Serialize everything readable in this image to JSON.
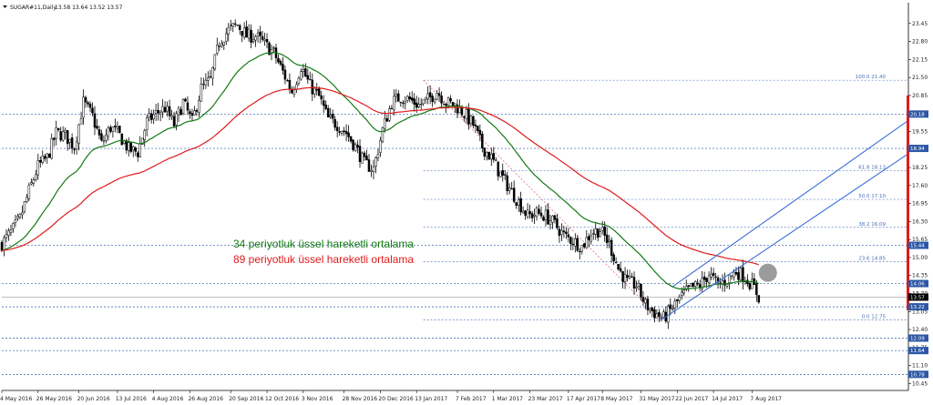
{
  "chart_data": {
    "type": "candlestick",
    "title": "SUGAR#11,Daily",
    "ohlc_label": "13.58 13.64 13.52 13.57",
    "symbol_menu_icon": "triangle-down-icon",
    "ylim": [
      10.2,
      24.2
    ],
    "y_ticks": [
      "23.45",
      "22.80",
      "22.15",
      "21.50",
      "20.85",
      "20.20",
      "19.55",
      "18.90",
      "18.25",
      "17.60",
      "16.95",
      "16.30",
      "15.65",
      "15.00",
      "14.35",
      "13.70",
      "13.05",
      "12.40",
      "11.75",
      "11.10",
      "10.45"
    ],
    "x_ticks": [
      {
        "label": "4 May 2016",
        "t": 0
      },
      {
        "label": "26 May 2016",
        "t": 16
      },
      {
        "label": "20 Jun 2016",
        "t": 34
      },
      {
        "label": "13 Jul 2016",
        "t": 51
      },
      {
        "label": "4 Aug 2016",
        "t": 67
      },
      {
        "label": "26 Aug 2016",
        "t": 83
      },
      {
        "label": "20 Sep 2016",
        "t": 101
      },
      {
        "label": "12 Oct 2016",
        "t": 117
      },
      {
        "label": "3 Nov 2016",
        "t": 133
      },
      {
        "label": "28 Nov 2016",
        "t": 151
      },
      {
        "label": "20 Dec 2016",
        "t": 167
      },
      {
        "label": "13 Jan 2017",
        "t": 183
      },
      {
        "label": "7 Feb 2017",
        "t": 201
      },
      {
        "label": "1 Mar 2017",
        "t": 217
      },
      {
        "label": "23 Mar 2017",
        "t": 233
      },
      {
        "label": "17 Apr 2017",
        "t": 250
      },
      {
        "label": "8 May 2017",
        "t": 265
      },
      {
        "label": "31 May 2017",
        "t": 282
      },
      {
        "label": "22 Jun 2017",
        "t": 298
      },
      {
        "label": "14 Jul 2017",
        "t": 314
      },
      {
        "label": "7 Aug 2017",
        "t": 331
      }
    ],
    "price_anchors": [
      [
        0,
        15.5
      ],
      [
        4,
        15.9
      ],
      [
        8,
        16.4
      ],
      [
        12,
        17.4
      ],
      [
        16,
        18.3
      ],
      [
        20,
        18.6
      ],
      [
        24,
        19.5
      ],
      [
        28,
        19.4
      ],
      [
        32,
        19.0
      ],
      [
        36,
        20.6
      ],
      [
        40,
        20.1
      ],
      [
        44,
        19.1
      ],
      [
        48,
        19.7
      ],
      [
        52,
        19.4
      ],
      [
        56,
        18.9
      ],
      [
        60,
        18.8
      ],
      [
        64,
        19.9
      ],
      [
        68,
        20.2
      ],
      [
        72,
        20.4
      ],
      [
        76,
        19.8
      ],
      [
        80,
        20.6
      ],
      [
        84,
        19.9
      ],
      [
        88,
        21.1
      ],
      [
        92,
        21.4
      ],
      [
        96,
        22.8
      ],
      [
        100,
        23.2
      ],
      [
        104,
        23.4
      ],
      [
        108,
        23.0
      ],
      [
        112,
        23.0
      ],
      [
        116,
        22.7
      ],
      [
        120,
        22.4
      ],
      [
        124,
        21.7
      ],
      [
        128,
        21.0
      ],
      [
        132,
        21.9
      ],
      [
        136,
        21.2
      ],
      [
        140,
        20.8
      ],
      [
        144,
        20.0
      ],
      [
        148,
        19.8
      ],
      [
        152,
        19.5
      ],
      [
        156,
        19.0
      ],
      [
        160,
        18.4
      ],
      [
        164,
        18.2
      ],
      [
        168,
        19.6
      ],
      [
        172,
        20.6
      ],
      [
        176,
        20.8
      ],
      [
        180,
        20.7
      ],
      [
        184,
        20.5
      ],
      [
        188,
        20.7
      ],
      [
        192,
        21.0
      ],
      [
        196,
        20.6
      ],
      [
        200,
        20.5
      ],
      [
        204,
        20.2
      ],
      [
        208,
        19.8
      ],
      [
        212,
        19.0
      ],
      [
        216,
        18.6
      ],
      [
        220,
        18.0
      ],
      [
        224,
        17.5
      ],
      [
        228,
        17.0
      ],
      [
        232,
        16.5
      ],
      [
        236,
        16.6
      ],
      [
        240,
        16.5
      ],
      [
        244,
        16.2
      ],
      [
        248,
        15.8
      ],
      [
        252,
        15.6
      ],
      [
        256,
        15.4
      ],
      [
        260,
        15.9
      ],
      [
        264,
        16.0
      ],
      [
        268,
        15.5
      ],
      [
        272,
        14.6
      ],
      [
        276,
        14.1
      ],
      [
        280,
        14.0
      ],
      [
        284,
        13.3
      ],
      [
        288,
        13.0
      ],
      [
        292,
        12.8
      ],
      [
        296,
        13.2
      ],
      [
        300,
        13.6
      ],
      [
        304,
        13.9
      ],
      [
        308,
        14.0
      ],
      [
        312,
        14.4
      ],
      [
        316,
        14.0
      ],
      [
        320,
        14.2
      ],
      [
        324,
        14.5
      ],
      [
        328,
        14.3
      ],
      [
        332,
        13.9
      ],
      [
        334,
        13.57
      ]
    ],
    "series": [
      {
        "name": "34 periyotluk üssel hareketli ortalama",
        "color": "#137a13"
      },
      {
        "name": "89 periyotluk üssel hareketli ortalama",
        "color": "#e01b1b"
      }
    ],
    "fibonacci": {
      "levels": [
        {
          "label": "100.0 21.40",
          "value": 21.4
        },
        {
          "label": "61.8 18.13",
          "value": 18.13
        },
        {
          "label": "50.0 17.10",
          "value": 17.1
        },
        {
          "label": "38.2 16.09",
          "value": 16.09
        },
        {
          "label": "23.6 14.85",
          "value": 14.85
        },
        {
          "label": "0.0 12.75",
          "value": 12.75
        }
      ],
      "start_t": 186,
      "end_t": 400
    },
    "fib_trendline": [
      [
        186,
        21.4
      ],
      [
        291,
        12.75
      ]
    ],
    "channel": {
      "color": "#3a6fd8",
      "upper": [
        [
          296,
          13.95
        ],
        [
          400,
          19.95
        ]
      ],
      "lower": [
        [
          291,
          12.75
        ],
        [
          400,
          18.75
        ]
      ]
    },
    "horizontal_levels": [
      {
        "label": "20.18",
        "value": 20.18
      },
      {
        "label": "18.94",
        "value": 18.94
      },
      {
        "label": "15.44",
        "value": 15.44
      },
      {
        "label": "14.06",
        "value": 14.06
      },
      {
        "label": "13.22",
        "value": 13.22
      },
      {
        "label": "12.09",
        "value": 12.09
      },
      {
        "label": "11.64",
        "value": 11.64
      },
      {
        "label": "10.78",
        "value": 10.78
      }
    ],
    "current_price": {
      "label": "13.57",
      "value": 13.57
    },
    "circle_marker_t": 338,
    "circle_marker_value": 14.45,
    "red_axis_bar": [
      20.85,
      13.1
    ],
    "level_color": "#2d57a6",
    "grid": false
  },
  "annotations": {
    "ema34": "34 periyotluk üssel hareketli ortalama",
    "ema89": "89 periyotluk üssel hareketli ortalama"
  }
}
